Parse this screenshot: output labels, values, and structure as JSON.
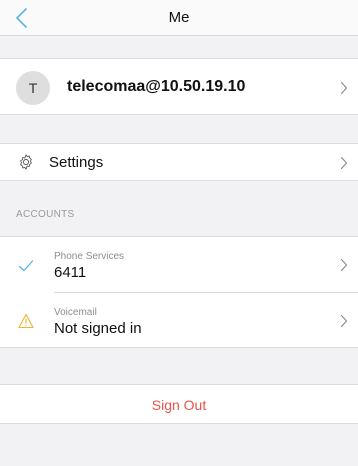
{
  "nav": {
    "title": "Me"
  },
  "profile": {
    "avatar_initial": "T",
    "name": "telecomaa@10.50.19.10"
  },
  "settings": {
    "label": "Settings"
  },
  "accounts": {
    "header": "ACCOUNTS",
    "items": [
      {
        "title": "Phone Services",
        "value": "6411",
        "icon": "checkmark-icon"
      },
      {
        "title": "Voicemail",
        "value": "Not signed in",
        "icon": "warning-icon"
      }
    ]
  },
  "sign_out": {
    "label": "Sign Out"
  },
  "colors": {
    "accent": "#5ab4e8",
    "destructive": "#e8524a",
    "warning": "#f0b429",
    "chevron": "#8e8e93"
  }
}
